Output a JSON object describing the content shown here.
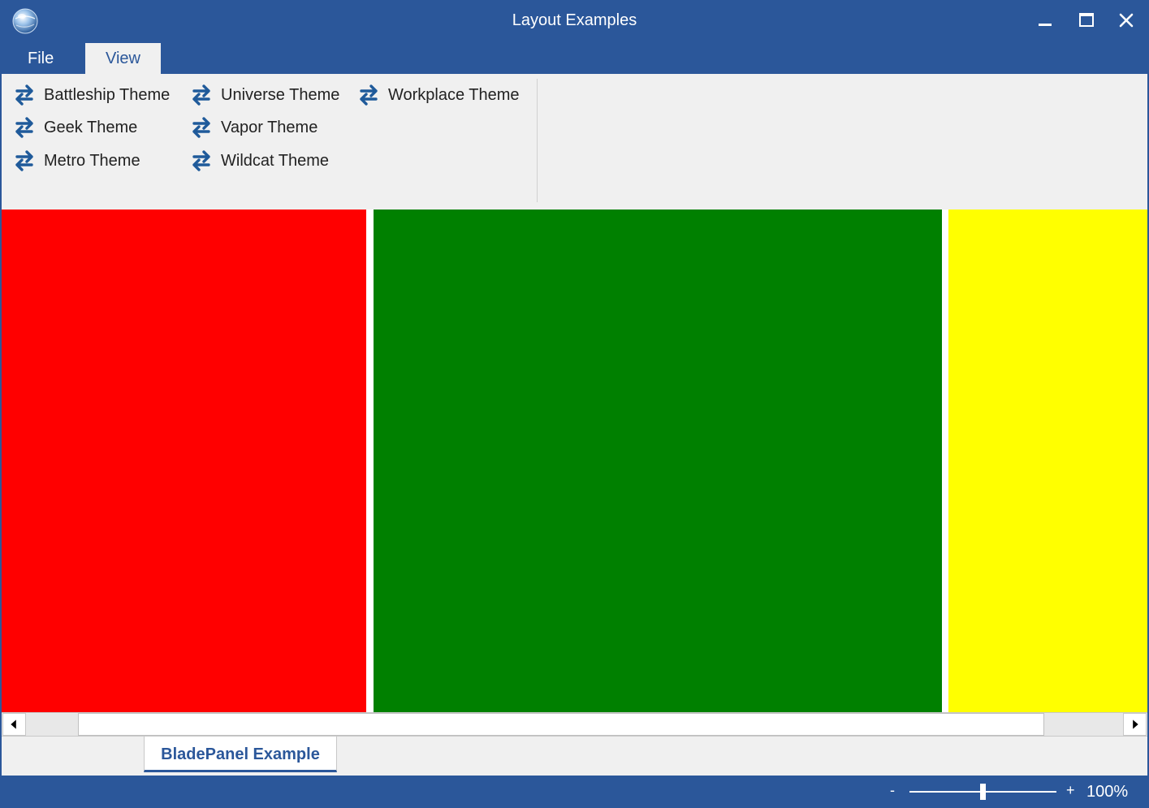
{
  "window": {
    "title": "Layout Examples",
    "icon": "globe-icon"
  },
  "menu": {
    "file_label": "File",
    "view_label": "View"
  },
  "ribbon": {
    "themes": [
      {
        "label": "Battleship Theme",
        "icon": "swap-arrows-icon"
      },
      {
        "label": "Geek Theme",
        "icon": "swap-arrows-icon"
      },
      {
        "label": "Metro Theme",
        "icon": "swap-arrows-icon"
      },
      {
        "label": "Universe Theme",
        "icon": "swap-arrows-icon"
      },
      {
        "label": "Vapor Theme",
        "icon": "swap-arrows-icon"
      },
      {
        "label": "Wildcat Theme",
        "icon": "swap-arrows-icon"
      },
      {
        "label": "Workplace Theme",
        "icon": "swap-arrows-icon"
      }
    ]
  },
  "blades": [
    {
      "color": "#ff0000"
    },
    {
      "color": "#008000"
    },
    {
      "color": "#ffff00"
    }
  ],
  "doc_tab": {
    "label": "BladePanel Example"
  },
  "status": {
    "zoom_minus": "-",
    "zoom_plus": "+",
    "zoom_level": "100%"
  },
  "colors": {
    "accent": "#2b579a",
    "ribbon_bg": "#f0f0f0",
    "icon_blue": "#1f5a9a"
  }
}
